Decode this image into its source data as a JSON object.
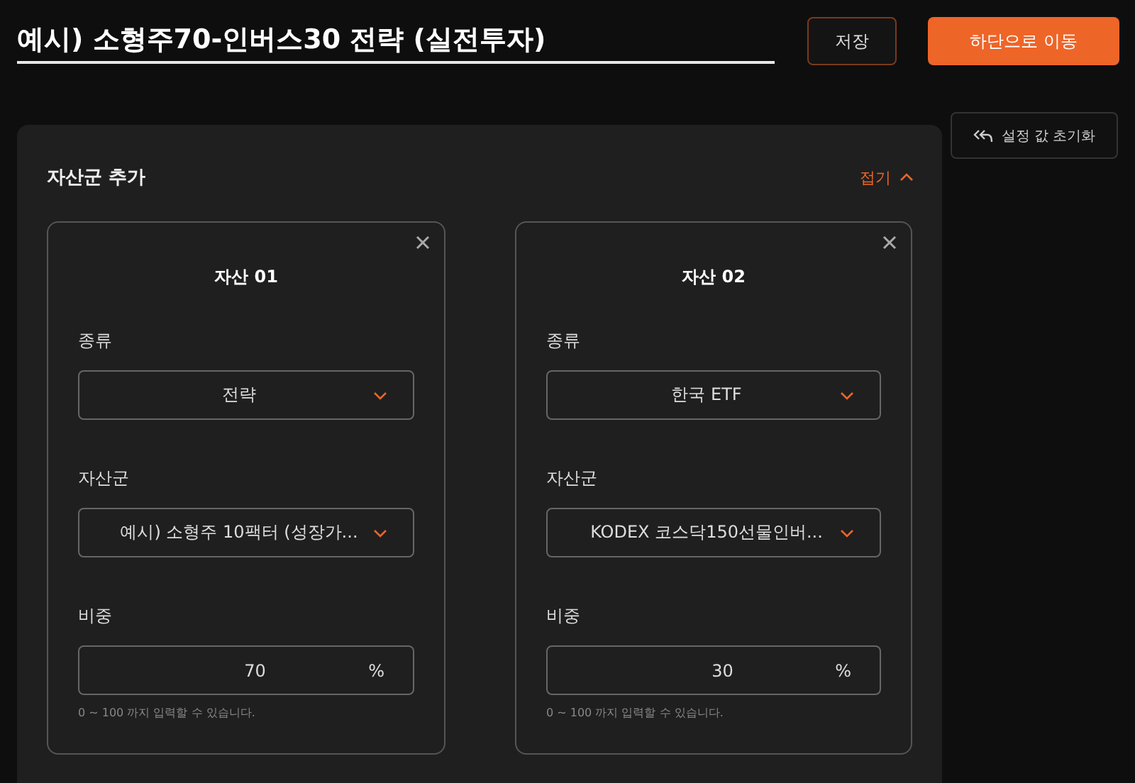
{
  "title_field": {
    "value": "예시) 소형주70-인버스30 전략 (실전투자)"
  },
  "buttons": {
    "save": "저장",
    "move_down": "하단으로 이동",
    "reset": "설정 값 초기화"
  },
  "section": {
    "title": "자산군 추가",
    "collapse": "접기",
    "expanded": true
  },
  "assets": [
    {
      "title": "자산 01",
      "type_label": "종류",
      "type_value": "전략",
      "class_label": "자산군",
      "class_value": "예시) 소형주 10팩터 (성장가...",
      "weight_label": "비중",
      "weight_value": "70",
      "unit": "%",
      "hint": "0 ~ 100 까지 입력할 수 있습니다."
    },
    {
      "title": "자산 02",
      "type_label": "종류",
      "type_value": "한국 ETF",
      "class_label": "자산군",
      "class_value": "KODEX 코스닥150선물인버...",
      "weight_label": "비중",
      "weight_value": "30",
      "unit": "%",
      "hint": "0 ~ 100 까지 입력할 수 있습니다."
    }
  ]
}
